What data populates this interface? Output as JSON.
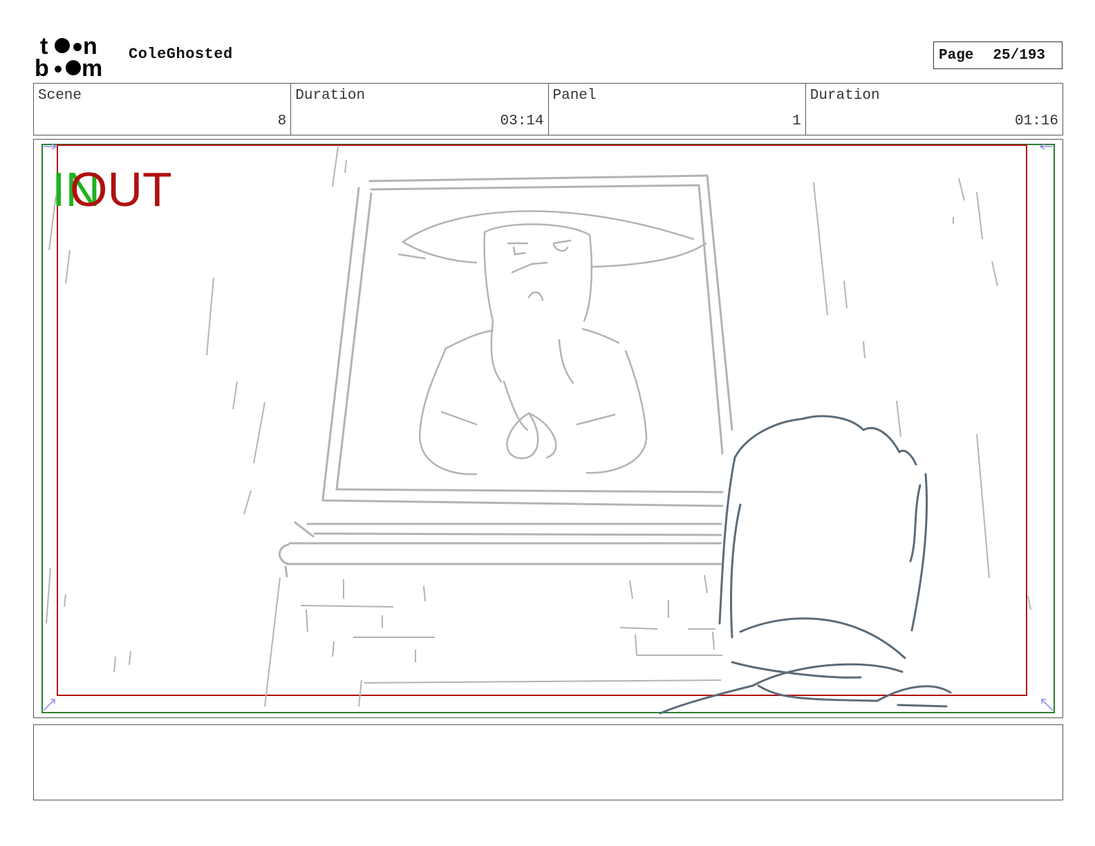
{
  "header": {
    "logo_text": "toon boom",
    "project_title": "ColeGhosted",
    "page_label": "Page",
    "page_number": "25/193"
  },
  "info": {
    "scene_label": "Scene",
    "scene_value": "8",
    "scene_duration_label": "Duration",
    "scene_duration_value": "03:14",
    "panel_label": "Panel",
    "panel_value": "1",
    "panel_duration_label": "Duration",
    "panel_duration_value": "01:16"
  },
  "panel_overlay": {
    "in_label": "IN",
    "out_label": "OUT",
    "in_color": "#1fb31f",
    "out_color": "#b01010",
    "safe_frame_color": "#b01010",
    "camera_frame_color": "#2e7d32"
  },
  "dialogue": {
    "text": ""
  }
}
